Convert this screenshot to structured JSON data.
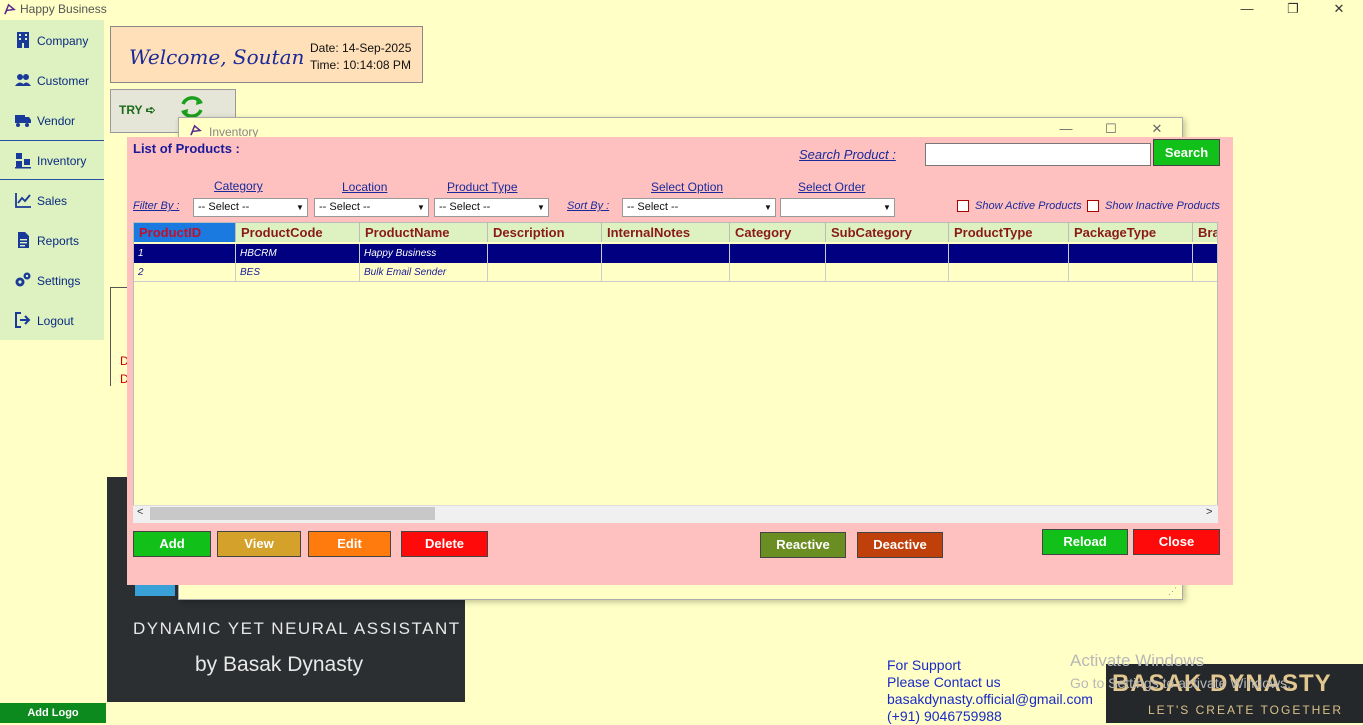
{
  "app": {
    "title": "Happy Business"
  },
  "window_controls": {
    "minimize": "—",
    "maximize": "❐",
    "close": "✕"
  },
  "sidebar": {
    "items": [
      {
        "label": "Company",
        "icon": "building-icon"
      },
      {
        "label": "Customer",
        "icon": "users-icon"
      },
      {
        "label": "Vendor",
        "icon": "truck-icon"
      },
      {
        "label": "Inventory",
        "icon": "inventory-icon"
      },
      {
        "label": "Sales",
        "icon": "chart-line-icon"
      },
      {
        "label": "Reports",
        "icon": "document-icon"
      },
      {
        "label": "Settings",
        "icon": "gears-icon"
      },
      {
        "label": "Logout",
        "icon": "logout-icon"
      }
    ],
    "add_logo": "Add Logo"
  },
  "welcome": {
    "text": "Welcome, Soutan",
    "date": "Date: 14-Sep-2025",
    "time": "Time: 10:14:08 PM"
  },
  "try_box": {
    "label": "TRY ➪"
  },
  "background": {
    "red_letters": [
      "D",
      "D"
    ]
  },
  "brand_panel": {
    "line1": "DYNAMIC YET NEURAL ASSISTANT",
    "line2": "by Basak Dynasty"
  },
  "support": {
    "line1": "For Support",
    "line2": "Please Contact us",
    "email": "basakdynasty.official@gmail.com",
    "phone": "(+91) 9046759988"
  },
  "activate_windows": {
    "title": "Activate Windows",
    "subtitle": "Go to Settings to activate Windows."
  },
  "basak_logo": {
    "name": "BASAK DYNASTY",
    "tagline": "LET'S CREATE TOGETHER"
  },
  "inventory": {
    "window_title": "Inventory",
    "list_title": "List of Products :",
    "search_label": "Search Product :",
    "search_value": "",
    "search_button": "Search",
    "filter_by": "Filter By :",
    "sort_by": "Sort By :",
    "filters": {
      "category": {
        "label": "Category",
        "value": "-- Select --"
      },
      "location": {
        "label": "Location",
        "value": "-- Select --"
      },
      "product_type": {
        "label": "Product Type",
        "value": "-- Select --"
      },
      "select_option": {
        "label": "Select Option",
        "value": "-- Select --"
      },
      "select_order": {
        "label": "Select Order",
        "value": ""
      }
    },
    "show_active": "Show Active Products",
    "show_inactive": "Show Inactive Products",
    "columns": [
      "ProductID",
      "ProductCode",
      "ProductName",
      "Description",
      "InternalNotes",
      "Category",
      "SubCategory",
      "ProductType",
      "PackageType",
      "Bra"
    ],
    "rows": [
      [
        "1",
        "HBCRM",
        "Happy Business",
        "",
        "",
        "",
        "",
        "",
        "",
        ""
      ],
      [
        "2",
        "BES",
        "Bulk Email Sender",
        "",
        "",
        "",
        "",
        "",
        "",
        ""
      ]
    ],
    "buttons": {
      "add": "Add",
      "view": "View",
      "edit": "Edit",
      "delete": "Delete",
      "reactive": "Reactive",
      "deactive": "Deactive",
      "reload": "Reload",
      "close": "Close"
    },
    "colors": {
      "add": "#11c11a",
      "view": "#d4a12a",
      "edit": "#ff7b0e",
      "delete": "#ff0a0a",
      "reactive": "#6b8e23",
      "deactive": "#c0400c",
      "reload": "#11c11a",
      "close": "#ff0a0a",
      "search": "#11c11a"
    }
  }
}
